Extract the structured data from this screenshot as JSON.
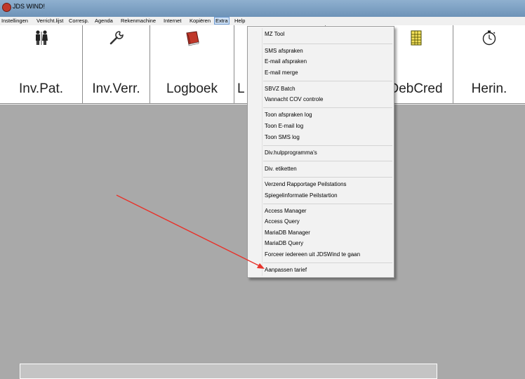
{
  "window": {
    "title": "JDS WIND!"
  },
  "menubar": {
    "items": [
      "Instellingen",
      "Verricht.lijst",
      "Corresp.",
      "Agenda",
      "Rekenmachine",
      "Internet",
      "Kopiëren",
      "Extra",
      "Help"
    ]
  },
  "toolbar": {
    "buttons": [
      {
        "label": "Inv.Pat.",
        "icon": "patients-icon"
      },
      {
        "label": "Inv.Verr.",
        "icon": "wrench-icon"
      },
      {
        "label": "Logboek",
        "icon": "book-icon"
      },
      {
        "label": "L",
        "icon": ""
      },
      {
        "label": "",
        "icon": ""
      },
      {
        "label": "DebCred",
        "icon": "ledger-icon"
      },
      {
        "label": "Herin.",
        "icon": "stopwatch-icon"
      }
    ]
  },
  "extra_menu": {
    "groups": [
      [
        "MZ Tool"
      ],
      [
        "SMS afspraken",
        "E-mail afspraken",
        "E-mail merge"
      ],
      [
        "SBVZ Batch",
        "Vannacht COV controle"
      ],
      [
        "Toon afspraken log",
        "Toon E-mail log",
        "Toon SMS log"
      ],
      [
        "Div.hulpprogramma's"
      ],
      [
        "Div. etiketten"
      ],
      [
        "Verzend Rapportage Peilstations",
        "Spiegelinformatie Peilstartion"
      ],
      [
        "Access Manager",
        "Access Query",
        "MariaDB Manager",
        "MariaDB Query",
        "Forceer iedereen uit JDSWind te gaan"
      ],
      [
        "Aanpassen tarief"
      ]
    ]
  },
  "colors": {
    "arrow": "#e8332b",
    "workspace": "#a9a9a9"
  }
}
